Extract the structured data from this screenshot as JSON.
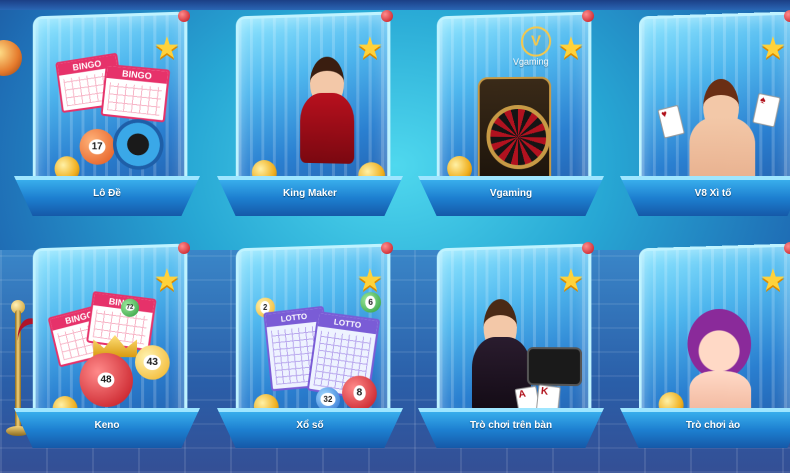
{
  "games": [
    {
      "id": "lo-de",
      "label": "Lô Đề",
      "ticket_text": "BINGO",
      "balls": [
        "17"
      ]
    },
    {
      "id": "king-maker",
      "label": "King Maker"
    },
    {
      "id": "vgaming",
      "label": "Vgaming",
      "logo_letter": "V",
      "logo_text": "Vgaming"
    },
    {
      "id": "v8-xi-to",
      "label": "V8 Xì tố"
    },
    {
      "id": "keno",
      "label": "Keno",
      "ticket_text": "BINGO",
      "balls": [
        "48",
        "43",
        "72"
      ]
    },
    {
      "id": "xo-so",
      "label": "Xổ số",
      "sheet_text": "LOTTO",
      "balls": [
        "2",
        "6",
        "32",
        "8"
      ]
    },
    {
      "id": "tro-choi-tren-ban",
      "label": "Trò chơi trên bàn"
    },
    {
      "id": "tro-choi-ao",
      "label": "Trò chơi ảo"
    }
  ],
  "colors": {
    "star": "#ffd23a",
    "accent": "#1d7fd0",
    "ticket": "#e6326a",
    "lotto": "#7a5cd6"
  },
  "icons": {
    "favorite": "star-icon",
    "notification": "red-dot-icon"
  }
}
